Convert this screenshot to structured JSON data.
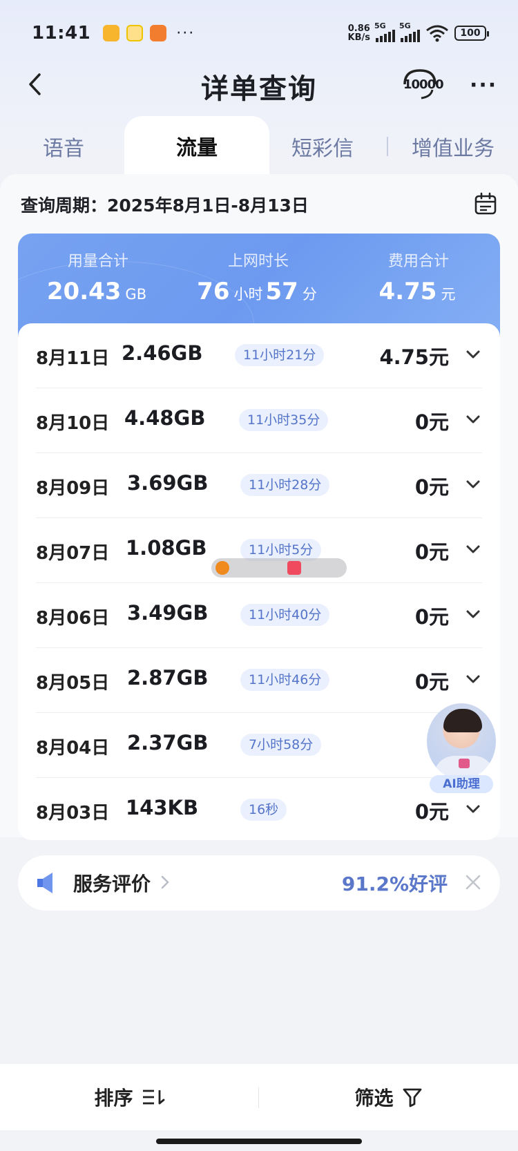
{
  "status_bar": {
    "time": "11:41",
    "speed_value": "0.86",
    "speed_unit": "KB/s",
    "signal1_label": "5G",
    "signal2_label": "5G",
    "battery": "100"
  },
  "header": {
    "title": "详单查询",
    "hotline": "10000"
  },
  "tabs": [
    {
      "label": "语音",
      "active": false
    },
    {
      "label": "流量",
      "active": true
    },
    {
      "label": "短彩信",
      "active": false
    },
    {
      "label": "增值业务",
      "active": false
    }
  ],
  "period": {
    "label": "查询周期：2025年8月1日-8月13日"
  },
  "summary": {
    "usage": {
      "label": "用量合计",
      "value": "20.43",
      "unit": "GB"
    },
    "duration": {
      "label": "上网时长",
      "hours": "76",
      "hours_unit": "小时",
      "minutes": "57",
      "minutes_unit": "分"
    },
    "fee": {
      "label": "费用合计",
      "value": "4.75",
      "unit": "元"
    }
  },
  "records": [
    {
      "date": "8月11日",
      "size": "2.46GB",
      "duration": "11小时21分",
      "fee": "4.75元"
    },
    {
      "date": "8月10日",
      "size": "4.48GB",
      "duration": "11小时35分",
      "fee": "0元"
    },
    {
      "date": "8月09日",
      "size": "3.69GB",
      "duration": "11小时28分",
      "fee": "0元"
    },
    {
      "date": "8月07日",
      "size": "1.08GB",
      "duration": "11小时5分",
      "fee": "0元"
    },
    {
      "date": "8月06日",
      "size": "3.49GB",
      "duration": "11小时40分",
      "fee": "0元"
    },
    {
      "date": "8月05日",
      "size": "2.87GB",
      "duration": "11小时46分",
      "fee": "0元"
    },
    {
      "date": "8月04日",
      "size": "2.37GB",
      "duration": "7小时58分",
      "fee": ""
    },
    {
      "date": "8月03日",
      "size": "143KB",
      "duration": "16秒",
      "fee": "0元"
    }
  ],
  "assistant": {
    "label": "AI助理"
  },
  "evaluation": {
    "label": "服务评价",
    "rate": "91.2%好评"
  },
  "bottom_bar": {
    "sort_label": "排序",
    "filter_label": "筛选"
  },
  "colors": {
    "accent": "#6d9af0",
    "duration_tag_bg": "#eaf0fd",
    "duration_tag_text": "#5474c9",
    "rating_text": "#5a77c9"
  }
}
